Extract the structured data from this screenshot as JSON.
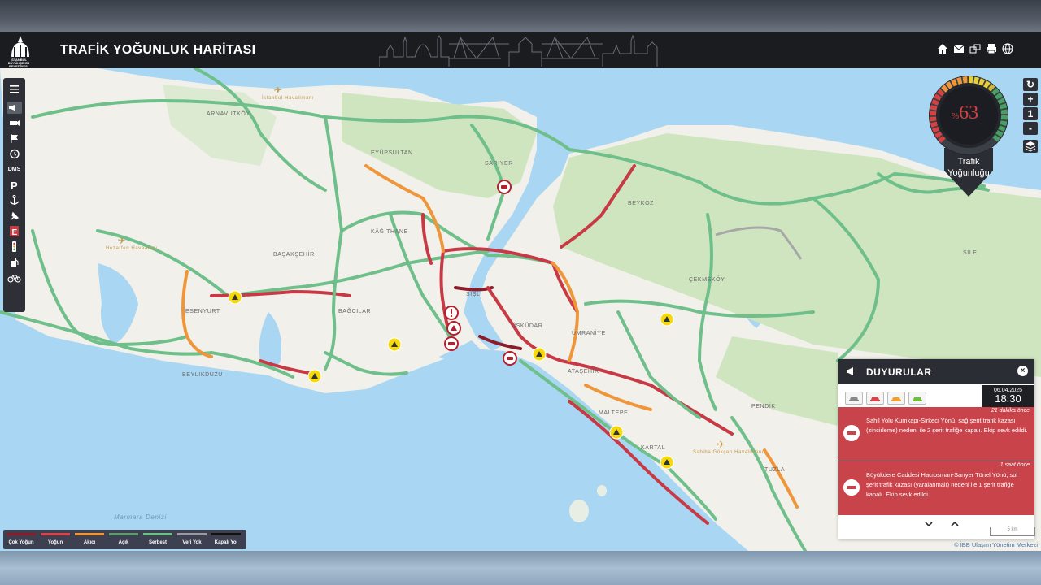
{
  "header": {
    "title": "TRAFİK YOĞUNLUK HARİTASI",
    "logo_text_1": "İSTANBUL",
    "logo_text_2": "BÜYÜKŞEHİR",
    "logo_text_3": "BELEDİYESİ",
    "icons": [
      "home-icon",
      "mail-icon",
      "windows-icon",
      "print-icon",
      "globe-icon"
    ]
  },
  "map": {
    "places": [
      {
        "id": "arnavutkoy",
        "label": "ARNAVUTKÖY"
      },
      {
        "id": "eyupsultan",
        "label": "EYÜPSULTAN"
      },
      {
        "id": "sariyer",
        "label": "SARIYER"
      },
      {
        "id": "beykoz",
        "label": "BEYKOZ"
      },
      {
        "id": "kagithane",
        "label": "KÂĞITHANE"
      },
      {
        "id": "basaksehir",
        "label": "BAŞAKŞEHİR"
      },
      {
        "id": "sile",
        "label": "ŞİLE"
      },
      {
        "id": "cekmekoy",
        "label": "ÇEKMEKÖY"
      },
      {
        "id": "esenyurt",
        "label": "ESENYURT"
      },
      {
        "id": "bagcilar",
        "label": "BAĞCILAR"
      },
      {
        "id": "sisli",
        "label": "ŞİŞLİ"
      },
      {
        "id": "uskudar",
        "label": "ÜSKÜDAR"
      },
      {
        "id": "umraniye",
        "label": "ÜMRANİYE"
      },
      {
        "id": "beylikduzu",
        "label": "BEYLİKDÜZÜ"
      },
      {
        "id": "atasehir",
        "label": "ATAŞEHİR"
      },
      {
        "id": "maltepe",
        "label": "MALTEPE"
      },
      {
        "id": "kartal",
        "label": "KARTAL"
      },
      {
        "id": "pendik",
        "label": "PENDİK"
      },
      {
        "id": "tuzla",
        "label": "TUZLA"
      }
    ],
    "water_label": "Marmara Denizi",
    "airports": {
      "istanbul": "İstanbul Havalimanı",
      "sabiha": "Sabiha Gökçen Havalimanı",
      "hezarfen": "Hezarfen Havaalanı"
    }
  },
  "gauge": {
    "percent": "63",
    "percent_sign": "%",
    "label_line1": "Trafik",
    "label_line2": "Yoğunluğu",
    "value": 0.63
  },
  "toolbar": {
    "dms_label": "DMS",
    "items": [
      "menu-icon",
      "announcement-icon",
      "camera-icon",
      "flag-icon",
      "history-icon",
      "dms-button",
      "parking-icon",
      "anchor-icon",
      "pin-icon",
      "e-icon",
      "traffic-light-icon",
      "fuel-icon",
      "bicycle-icon"
    ]
  },
  "zoom_controls": {
    "refresh": "↻",
    "plus": "+",
    "one": "1",
    "minus": "-"
  },
  "announcements": {
    "title": "DUYURULAR",
    "close": "×",
    "date": "06.04.2025",
    "time": "18:30",
    "items": [
      {
        "ago": "21 dakika önce",
        "text": "Sahil Yolu Kumkapı-Sirkeci Yönü, sağ şerit trafik kazası (zincirleme) nedeni ile 2 şerit trafiğe kapalı. Ekip sevk edildi."
      },
      {
        "ago": "1 saat önce",
        "text": "Büyükdere Caddesi Hacıosman-Sarıyer Tünel Yönü, sol şerit trafik kazası (yaralanmalı) nedeni ile 1 şerit trafiğe kapalı. Ekip sevk edildi."
      }
    ],
    "nav_down": "⌄",
    "nav_up": "⌃"
  },
  "legend": [
    {
      "label": "Çok Yoğun",
      "color": "#8b1c2c"
    },
    {
      "label": "Yoğun",
      "color": "#d9434b"
    },
    {
      "label": "Akıcı",
      "color": "#f0963a"
    },
    {
      "label": "Açık",
      "color": "#5f9b6e"
    },
    {
      "label": "Serbest",
      "color": "#6fbf8b"
    },
    {
      "label": "Veri Yok",
      "color": "#9a9aa4"
    },
    {
      "label": "Kapalı Yol",
      "color": "#111111"
    }
  ],
  "scale_label": "5 km",
  "copyright": "© İBB Ulaşım Yönetim Merkezi"
}
